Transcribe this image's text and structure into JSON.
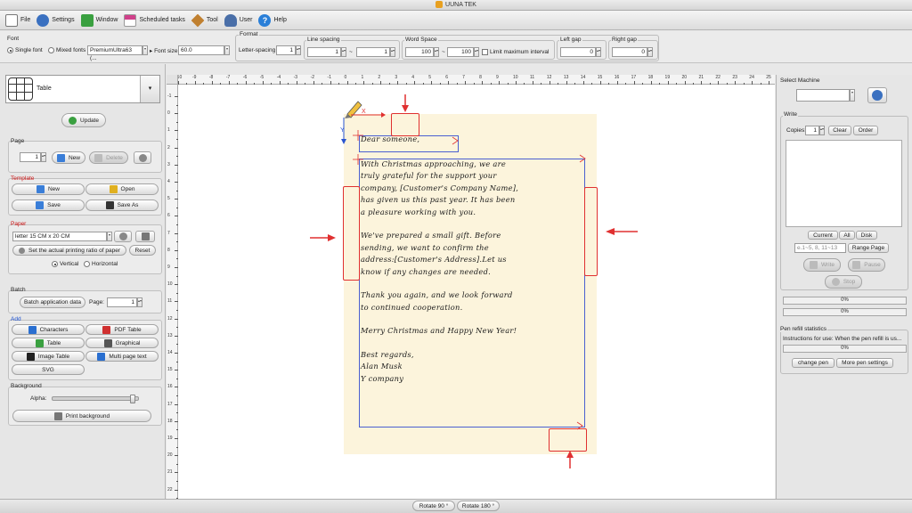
{
  "window": {
    "title": "UUNA TEK"
  },
  "menu": [
    {
      "label": "File",
      "color": "#555555"
    },
    {
      "label": "Settings",
      "color": "#3a70c0"
    },
    {
      "label": "Window",
      "color": "#3aa040"
    },
    {
      "label": "Scheduled tasks",
      "color": "#d0408a"
    },
    {
      "label": "Tool",
      "color": "#c08030"
    },
    {
      "label": "User",
      "color": "#4a6fa8"
    },
    {
      "label": "Help",
      "color": "#2a7fd8"
    }
  ],
  "font_group": {
    "title": "Font",
    "single_font": "Single font",
    "mixed_fonts": "Mixed fonts",
    "font_name": "PremiumUltra63 (...",
    "font_size_label": "Font size",
    "font_size": "60.0"
  },
  "format_group": {
    "title": "Format",
    "letter_spacing_label": "Letter-spacing",
    "letter_spacing": "1",
    "line_spacing_label": "Line spacing",
    "line_spacing_min": "1",
    "line_spacing_max": "1",
    "tilde": "~",
    "word_space_label": "Word Space",
    "word_space_min": "100",
    "word_space_max": "100",
    "limit_interval": "Limit maximum interval",
    "left_gap_label": "Left gap",
    "left_gap": "0",
    "right_gap_label": "Right gap",
    "right_gap": "0"
  },
  "left": {
    "element_type": "Table",
    "update": "Update",
    "page_title": "Page",
    "page_value": "1",
    "new": "New",
    "delete": "Delete",
    "template_title": "Template",
    "t_new": "New",
    "t_open": "Open",
    "t_save": "Save",
    "t_save_as": "Save As",
    "paper_title": "Paper",
    "paper_size": "letter 15 CM x 20 CM",
    "set_ratio": "Set the actual printing ratio of paper",
    "reset": "Reset",
    "vertical": "Vertical",
    "horizontal": "Horizontal",
    "batch_title": "Batch",
    "batch_data": "Batch application data",
    "batch_page_label": "Page:",
    "batch_page": "1",
    "add_title": "Add",
    "characters": "Characters",
    "pdf_table": "PDF Table",
    "table": "Table",
    "graphical": "Graphical",
    "image_table": "Image Table",
    "multi_page_text": "Multi page text",
    "svg": "SVG",
    "background_title": "Background",
    "alpha": "Alpha:",
    "alpha_level": 0.97,
    "print_background": "Print background"
  },
  "ruler": {
    "h_labels": [
      "-10",
      "-9",
      "-8",
      "-7",
      "-6",
      "-5",
      "-4",
      "-3",
      "-2",
      "-1",
      "0",
      "1",
      "2",
      "3",
      "4",
      "5",
      "6",
      "7",
      "8",
      "9",
      "10",
      "11",
      "12",
      "13",
      "14",
      "15",
      "16",
      "17",
      "18",
      "19",
      "20",
      "21",
      "22",
      "23",
      "24",
      "25"
    ],
    "v_labels": [
      "-1",
      "0",
      "1",
      "2",
      "3",
      "4",
      "5",
      "6",
      "7",
      "8",
      "9",
      "10",
      "11",
      "12",
      "13",
      "14",
      "15",
      "16",
      "17",
      "18",
      "19",
      "20",
      "21",
      "22"
    ]
  },
  "canvas": {
    "axis_x": "X",
    "axis_y": "Y",
    "letter": [
      "Dear someone,",
      "With Christmas approaching, we are\ntruly grateful for the support your\ncompany, [Customer's Company Name],\nhas given us this past year. It has been\na pleasure working with you.",
      "We've prepared a small gift. Before\nsending, we want to confirm the\naddress:[Customer's Address].Let us\nknow if any changes are needed.",
      "Thank you again, and we look forward\nto continued cooperation.",
      "Merry Christmas and Happy New Year!",
      "Best regards,\nAlan Musk\nY company"
    ]
  },
  "right": {
    "select_machine": "Select Machine",
    "write_title": "Write",
    "copies_label": "Copies:",
    "copies": "1",
    "clear": "Clear",
    "order": "Order",
    "current": "Current",
    "all": "All",
    "disk": "Disk",
    "range_placeholder": "e.1~5, 8, 11~13",
    "range_page": "Range Page",
    "write": "Write",
    "pause": "Pause",
    "stop": "Stop",
    "progress1": "0%",
    "progress2": "0%",
    "pen_refill_title": "Pen refill statistics",
    "instructions": "Instructions for use: When the pen refill is us...",
    "progress3": "0%",
    "change_pen": "change pen",
    "more_pen_settings": "More pen settings"
  },
  "bottom": {
    "rotate90": "Rotate 90 °",
    "rotate180": "Rotate 180 °"
  },
  "colors": {
    "accent_red": "#e03030",
    "paper": "#fcf4dc",
    "guide_blue": "#4a5fd0"
  }
}
